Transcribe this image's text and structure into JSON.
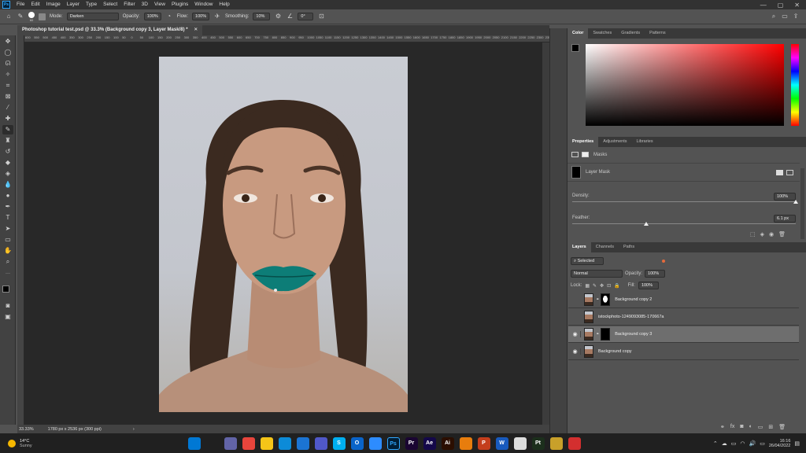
{
  "app": {
    "logo": "Ps",
    "menus": [
      "File",
      "Edit",
      "Image",
      "Layer",
      "Type",
      "Select",
      "Filter",
      "3D",
      "View",
      "Plugins",
      "Window",
      "Help"
    ]
  },
  "options_bar": {
    "brush_size": "60",
    "mode_label": "Mode:",
    "mode_value": "Darken",
    "opacity_label": "Opacity:",
    "opacity_value": "100%",
    "flow_label": "Flow:",
    "flow_value": "100%",
    "smoothing_label": "Smoothing:",
    "smoothing_value": "10%",
    "angle_value": "0°"
  },
  "document": {
    "tab_title": "Photoshop tutorial test.psd @ 33.3% (Background copy 3, Layer Mask/8) *",
    "ruler_h": [
      "600",
      "550",
      "500",
      "450",
      "400",
      "350",
      "300",
      "250",
      "200",
      "150",
      "100",
      "50",
      "0",
      "50",
      "100",
      "150",
      "200",
      "250",
      "300",
      "350",
      "400",
      "450",
      "500",
      "550",
      "600",
      "650",
      "700",
      "750",
      "800",
      "850",
      "900",
      "950",
      "1000",
      "1050",
      "1100",
      "1150",
      "1200",
      "1250",
      "1300",
      "1350",
      "1400",
      "1450",
      "1500",
      "1550",
      "1600",
      "1650",
      "1700",
      "1750",
      "1800",
      "1850",
      "1900",
      "1950",
      "2000",
      "2050",
      "2100",
      "2150",
      "2200",
      "2250",
      "2300",
      "2350",
      "2400",
      "2450",
      "25",
      "27"
    ]
  },
  "status": {
    "zoom": "33.33%",
    "dimensions": "1780 px x 2536 px (300 ppi)"
  },
  "color_panel": {
    "tabs": [
      "Color",
      "Swatches",
      "Gradients",
      "Patterns"
    ],
    "hue_color": "#ff0000"
  },
  "properties_panel": {
    "tabs": [
      "Properties",
      "Adjustments",
      "Libraries"
    ],
    "masks_label": "Masks",
    "layer_mask_label": "Layer Mask",
    "density_label": "Density:",
    "density_value": "100%",
    "density_level": 1.0,
    "feather_label": "Feather:",
    "feather_value": "6.1 px",
    "feather_level": 0.33
  },
  "layers_panel": {
    "tabs": [
      "Layers",
      "Channels",
      "Paths"
    ],
    "filter_value": "Selected",
    "blend_mode": "Normal",
    "opacity_label": "Opacity:",
    "opacity_value": "100%",
    "lock_label": "Lock:",
    "fill_label": "Fill:",
    "fill_value": "100%",
    "layers": [
      {
        "name": "Background copy 2",
        "visible": false,
        "selected": false,
        "mask": "white-silhouette"
      },
      {
        "name": "istockphoto-1249093085-170667a",
        "visible": false,
        "selected": false,
        "mask": "none"
      },
      {
        "name": "Background copy 3",
        "visible": true,
        "selected": true,
        "mask": "black"
      },
      {
        "name": "Background copy",
        "visible": true,
        "selected": false,
        "mask": "none"
      }
    ]
  },
  "taskbar": {
    "weather_temp": "14°C",
    "weather_desc": "Sunny",
    "time": "16:16",
    "date": "26/04/2022",
    "apps": [
      {
        "name": "windows-start",
        "label": "",
        "color": "#0078d4"
      },
      {
        "name": "search",
        "label": "",
        "color": "#202020"
      },
      {
        "name": "teams-chat",
        "label": "",
        "color": "#6264a7"
      },
      {
        "name": "chrome",
        "label": "",
        "color": "#e8453c"
      },
      {
        "name": "file-explorer",
        "label": "",
        "color": "#f5c518"
      },
      {
        "name": "edge",
        "label": "",
        "color": "#0c8bd8"
      },
      {
        "name": "mail",
        "label": "",
        "color": "#1b74d3"
      },
      {
        "name": "teams",
        "label": "",
        "color": "#5058c9"
      },
      {
        "name": "skype",
        "label": "S",
        "color": "#00aff0"
      },
      {
        "name": "outlook",
        "label": "O",
        "color": "#0a64c9"
      },
      {
        "name": "zoom",
        "label": "",
        "color": "#2d8cff"
      },
      {
        "name": "photoshop",
        "label": "Ps",
        "color": "#001e36"
      },
      {
        "name": "premiere",
        "label": "Pr",
        "color": "#1a0532"
      },
      {
        "name": "after-effects",
        "label": "Ae",
        "color": "#14084a"
      },
      {
        "name": "illustrator",
        "label": "Ai",
        "color": "#2b0e00"
      },
      {
        "name": "blender",
        "label": "",
        "color": "#e87d0d"
      },
      {
        "name": "powerpoint",
        "label": "P",
        "color": "#c43e1c"
      },
      {
        "name": "word",
        "label": "W",
        "color": "#185abd"
      },
      {
        "name": "inkscape",
        "label": "",
        "color": "#dddddd"
      },
      {
        "name": "pt",
        "label": "Pt",
        "color": "#1c2f1c"
      },
      {
        "name": "capture-one",
        "label": "",
        "color": "#c8a02a"
      },
      {
        "name": "vectorworks",
        "label": "",
        "color": "#d32f2f"
      }
    ]
  }
}
